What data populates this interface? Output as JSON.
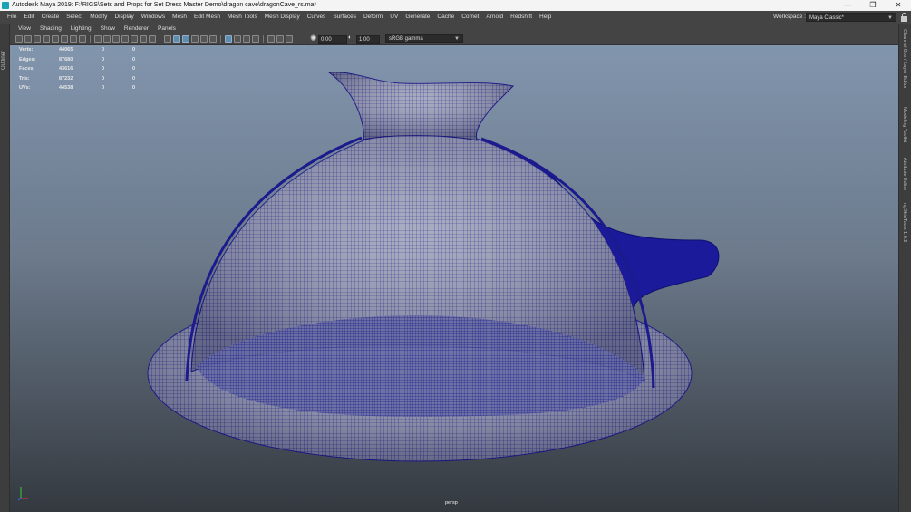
{
  "window": {
    "title": "Autodesk Maya 2019: F:\\RIGS\\Sets and Props for Set Dress Master Demo\\dragon cave\\dragonCave_rs.ma*",
    "minimize": "—",
    "maximize": "❐",
    "close": "✕"
  },
  "menubar": {
    "items": [
      "File",
      "Edit",
      "Create",
      "Select",
      "Modify",
      "Display",
      "Windows",
      "Mesh",
      "Edit Mesh",
      "Mesh Tools",
      "Mesh Display",
      "Curves",
      "Surfaces",
      "Deform",
      "UV",
      "Generate",
      "Cache",
      "Comet",
      "Arnold",
      "Redshift",
      "Help"
    ],
    "workspace_label": "Workspace :",
    "workspace_value": "Maya Classic*"
  },
  "side_tabs": {
    "left": "Outliner",
    "right": [
      "Channel Box / Layer Editor",
      "Modeling Toolkit",
      "Attribute Editor",
      "ngSkinTools 1.6.2"
    ]
  },
  "panel_menu": [
    "View",
    "Shading",
    "Lighting",
    "Show",
    "Renderer",
    "Panels"
  ],
  "toolbar": {
    "exposure": "0.00",
    "gamma": "1.00",
    "color_space": "sRGB gamma"
  },
  "hud": {
    "rows": [
      {
        "label": "Verts:",
        "v1": "44065",
        "v2": "0",
        "v3": "0"
      },
      {
        "label": "Edges:",
        "v1": "87680",
        "v2": "0",
        "v3": "0"
      },
      {
        "label": "Faces:",
        "v1": "43616",
        "v2": "0",
        "v3": "0"
      },
      {
        "label": "Tris:",
        "v1": "87232",
        "v2": "0",
        "v3": "0"
      },
      {
        "label": "UVs:",
        "v1": "44538",
        "v2": "0",
        "v3": "0"
      }
    ]
  },
  "viewport": {
    "camera": "persp",
    "wire_color": "#1c1a8c",
    "mesh_fill": "#9a9fb6"
  }
}
